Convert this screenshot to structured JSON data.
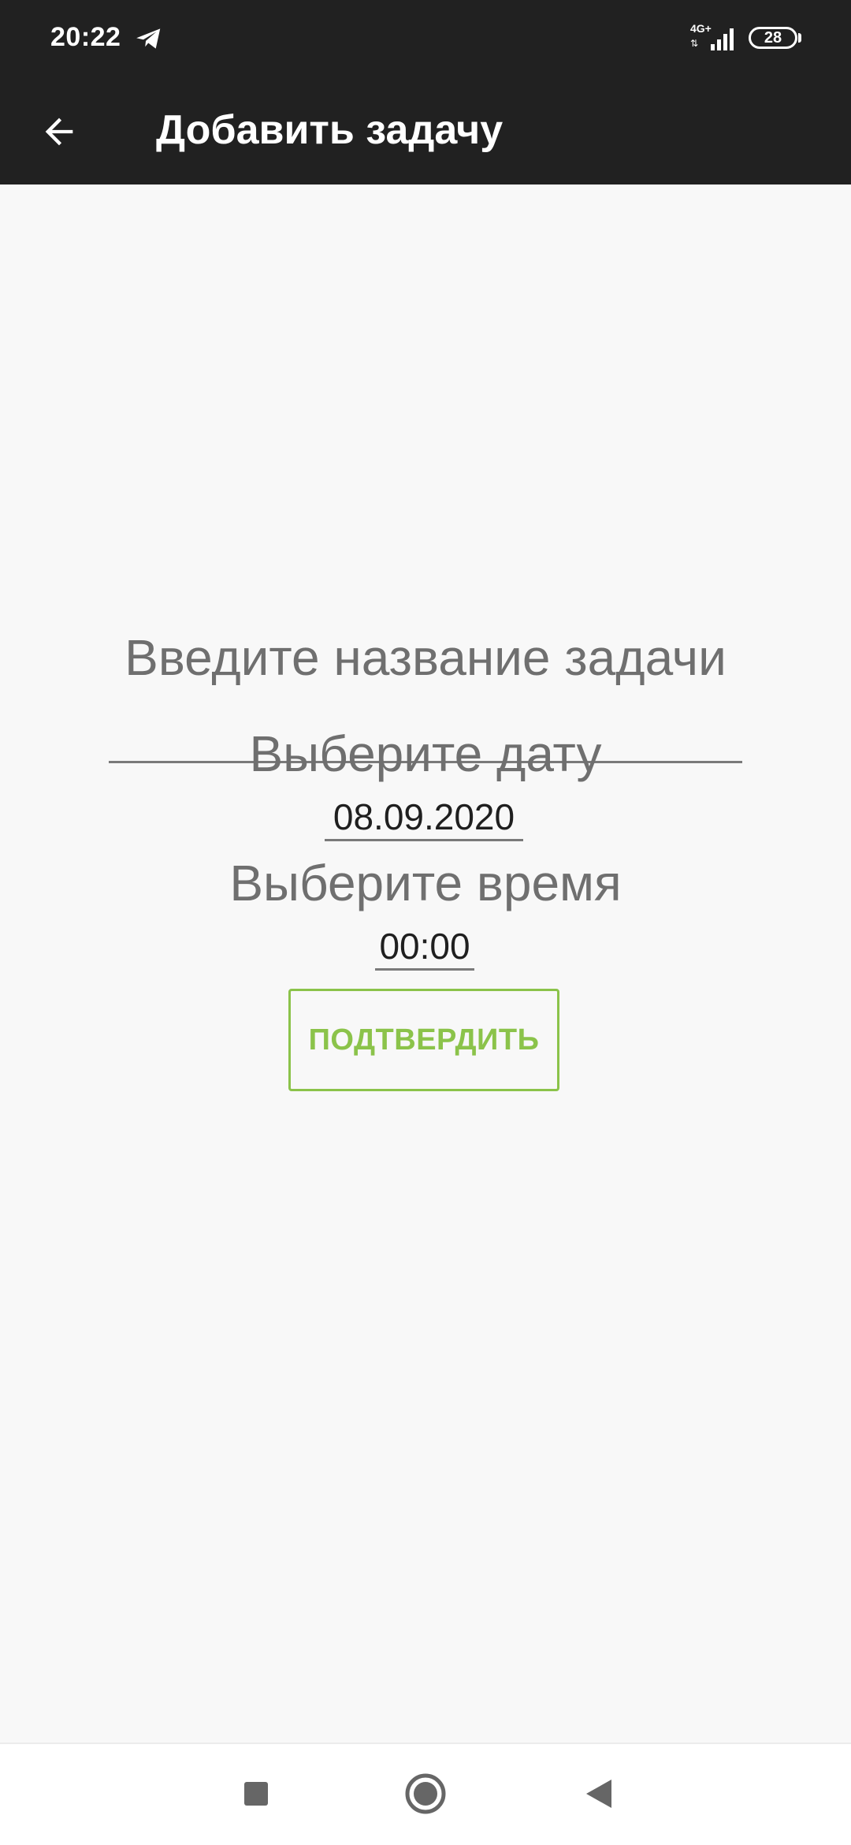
{
  "status_bar": {
    "time": "20:22",
    "network_type": "4G+",
    "battery_level": "28",
    "icons": [
      "telegram-icon",
      "signal-icon",
      "battery-icon"
    ]
  },
  "app_bar": {
    "title": "Добавить задачу",
    "back_icon": "arrow-left-icon",
    "background": "#212121"
  },
  "form": {
    "task_label": "Введите название задачи",
    "task_value": "",
    "date_label": "Выберите дату",
    "date_value": "08.09.2020",
    "time_label": "Выберите время",
    "time_value": "00:00",
    "confirm_label": "ПОДТВЕРДИТЬ",
    "accent_color": "#8bc34a"
  },
  "nav_bar": {
    "icons": [
      "recents-square-icon",
      "home-circle-icon",
      "back-triangle-icon"
    ]
  }
}
